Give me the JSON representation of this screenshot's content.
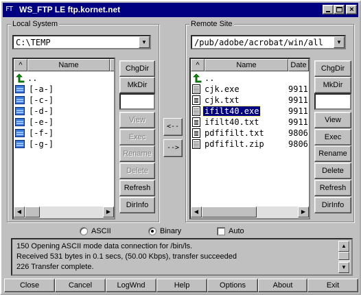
{
  "window": {
    "title": "WS_FTP LE ftp.kornet.net",
    "app_icon_text": "FT",
    "controls": {
      "minimize": "minimize",
      "maximize": "maximize",
      "close": "×"
    }
  },
  "local": {
    "group_label": "Local System",
    "path": "C:\\TEMP",
    "columns": {
      "sort": "^",
      "name": "Name"
    },
    "files": [
      {
        "name": "..",
        "icon": "up-folder-icon"
      },
      {
        "name": "[-a-]",
        "icon": "drive-icon"
      },
      {
        "name": "[-c-]",
        "icon": "drive-icon"
      },
      {
        "name": "[-d-]",
        "icon": "drive-icon"
      },
      {
        "name": "[-e-]",
        "icon": "drive-icon"
      },
      {
        "name": "[-f-]",
        "icon": "drive-icon"
      },
      {
        "name": "[-g-]",
        "icon": "drive-icon"
      }
    ],
    "buttons": {
      "chgdir": "ChgDir",
      "mkdir": "MkDir",
      "view": "View",
      "exec": "Exec",
      "rename": "Rename",
      "delete": "Delete",
      "refresh": "Refresh",
      "dirinfo": "DirInfo"
    }
  },
  "remote": {
    "group_label": "Remote Site",
    "path": "/pub/adobe/acrobat/win/all",
    "columns": {
      "sort": "^",
      "name": "Name",
      "date": "Date"
    },
    "files": [
      {
        "name": "..",
        "date": "",
        "icon": "up-folder-icon"
      },
      {
        "name": "cjk.exe",
        "date": "9911",
        "icon": "binary-file-icon"
      },
      {
        "name": "cjk.txt",
        "date": "9911",
        "icon": "text-file-icon"
      },
      {
        "name": "ifilt40.exe",
        "date": "9911",
        "icon": "binary-file-icon",
        "selected": true
      },
      {
        "name": "ifilt40.txt",
        "date": "9911",
        "icon": "text-file-icon"
      },
      {
        "name": "pdfifilt.txt",
        "date": "9806",
        "icon": "text-file-icon"
      },
      {
        "name": "pdfifilt.zip",
        "date": "9806",
        "icon": "binary-file-icon"
      }
    ],
    "buttons": {
      "chgdir": "ChgDir",
      "mkdir": "MkDir",
      "view": "View",
      "exec": "Exec",
      "rename": "Rename",
      "delete": "Delete",
      "refresh": "Refresh",
      "dirinfo": "DirInfo"
    }
  },
  "transfer": {
    "download": "<--",
    "upload": "-->"
  },
  "mode": {
    "ascii": "ASCII",
    "binary": "Binary",
    "auto": "Auto",
    "selected": "binary",
    "auto_checked": false
  },
  "log": {
    "lines": [
      "150 Opening ASCII mode data connection for /bin/ls.",
      "Received 531 bytes in 0.1 secs, (50.00 Kbps), transfer succeeded",
      "226 Transfer complete."
    ]
  },
  "bottom_buttons": {
    "close": "Close",
    "cancel": "Cancel",
    "logwnd": "LogWnd",
    "help": "Help",
    "options": "Options",
    "about": "About",
    "exit": "Exit"
  }
}
